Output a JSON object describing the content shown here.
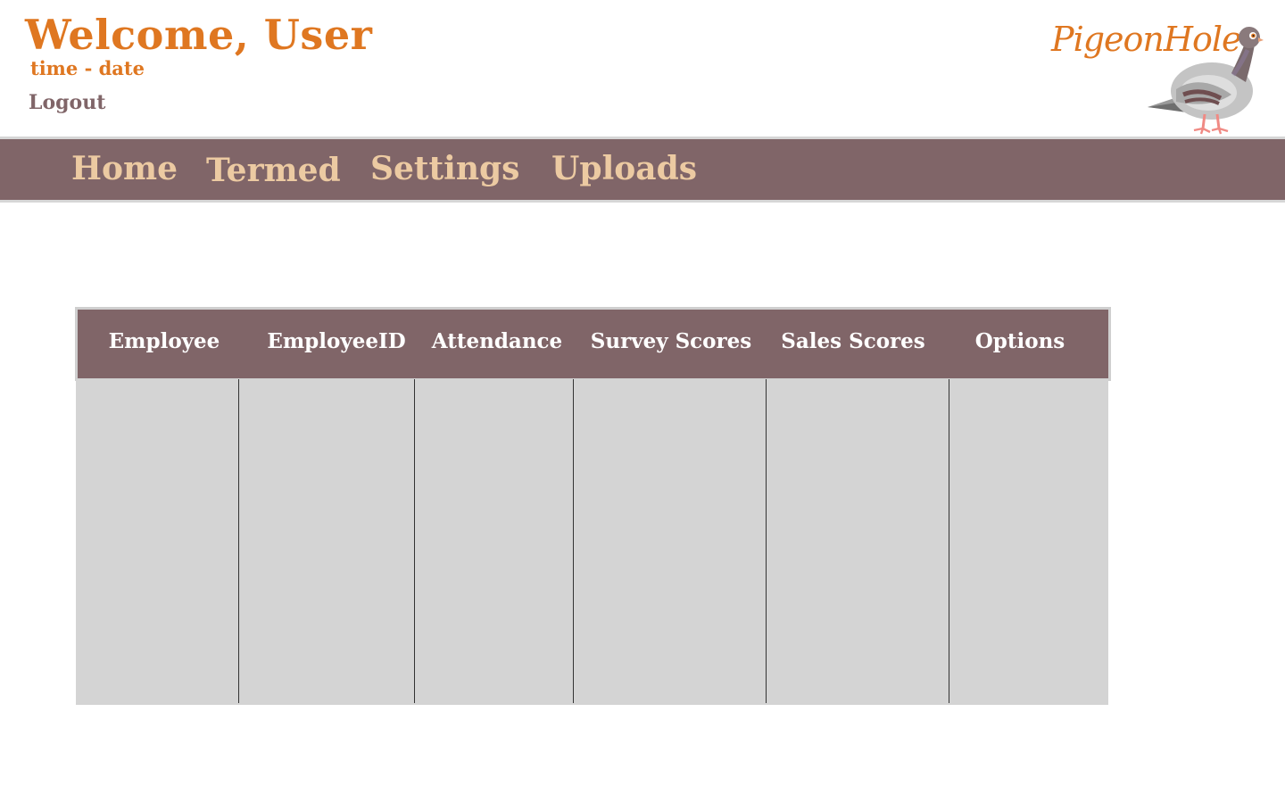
{
  "header": {
    "welcome": "Welcome, User",
    "timedate": "time - date",
    "logout": "Logout"
  },
  "brand": {
    "name": "PigeonHole",
    "mascot": "pigeon-icon"
  },
  "nav": {
    "items": [
      {
        "label": "Home"
      },
      {
        "label": "Termed"
      },
      {
        "label": "Settings"
      },
      {
        "label": "Uploads"
      }
    ]
  },
  "table": {
    "columns": [
      "Employee",
      "EmployeeID",
      "Attendance",
      "Survey Scores",
      "Sales Scores",
      "Options"
    ],
    "rows": []
  },
  "colors": {
    "accent": "#df7721",
    "brand_mauve": "#806568",
    "nav_text": "#eccaa2",
    "table_body": "#d4d4d4"
  }
}
